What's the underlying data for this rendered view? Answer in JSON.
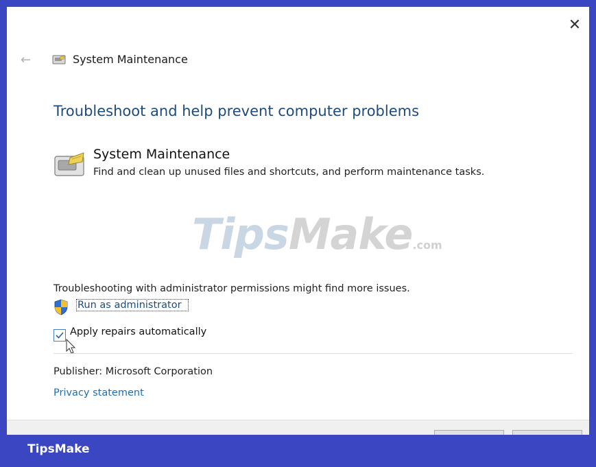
{
  "window": {
    "breadcrumb_title": "System Maintenance",
    "close_glyph": "✕",
    "back_glyph": "←"
  },
  "main": {
    "heading": "Troubleshoot and help prevent computer problems",
    "tool_name": "System Maintenance",
    "tool_description": "Find and clean up unused files and shortcuts, and perform maintenance tasks.",
    "admin_note": "Troubleshooting with administrator permissions might find more issues.",
    "run_as_admin_label": "Run as administrator",
    "apply_repairs_label": "Apply repairs automatically",
    "apply_repairs_checked": true,
    "publisher": "Publisher:  Microsoft Corporation",
    "privacy_link": "Privacy statement"
  },
  "watermark": {
    "text_a": "Tips",
    "text_b": "Make",
    "text_c": ".com"
  },
  "branding": {
    "footer_brand": "TipsMake"
  },
  "colors": {
    "frame": "#3a46c2",
    "heading": "#1f4a7c",
    "link": "#1f6fb0"
  },
  "icons": {
    "back": "back-arrow-icon",
    "breadcrumb": "system-maintenance-icon",
    "tool": "system-maintenance-icon",
    "shield": "uac-shield-icon",
    "close": "close-icon"
  }
}
